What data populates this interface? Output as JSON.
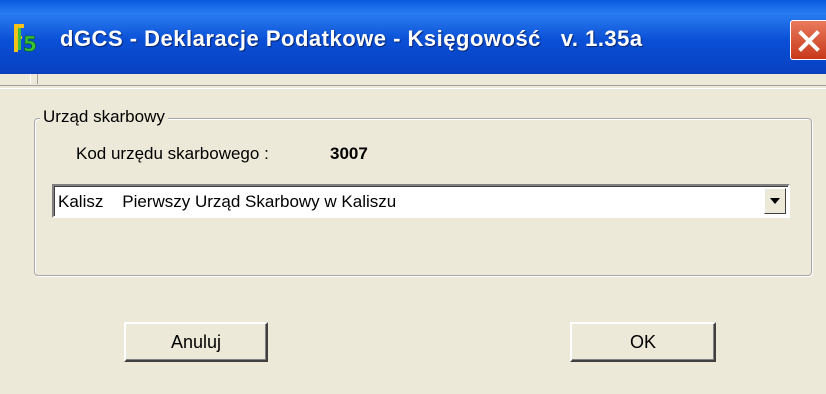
{
  "window": {
    "title": "dGCS - Deklaracje Podatkowe - Księgowość   v. 1.35a",
    "app_icon": "dgcs-app-icon",
    "close_icon": "close-icon"
  },
  "group": {
    "legend": "Urząd skarbowy",
    "kod_label": "Kod urzędu skarbowego :",
    "kod_value": "3007"
  },
  "office_select": {
    "value": "Kalisz    Pierwszy Urząd Skarbowy w Kaliszu",
    "dropdown_icon": "chevron-down-icon"
  },
  "buttons": {
    "cancel_label": "Anuluj",
    "ok_label": "OK"
  },
  "colors": {
    "titlebar": "#0a4fd6",
    "close_button": "#d9502c",
    "dialog_background": "#ece9d8"
  }
}
